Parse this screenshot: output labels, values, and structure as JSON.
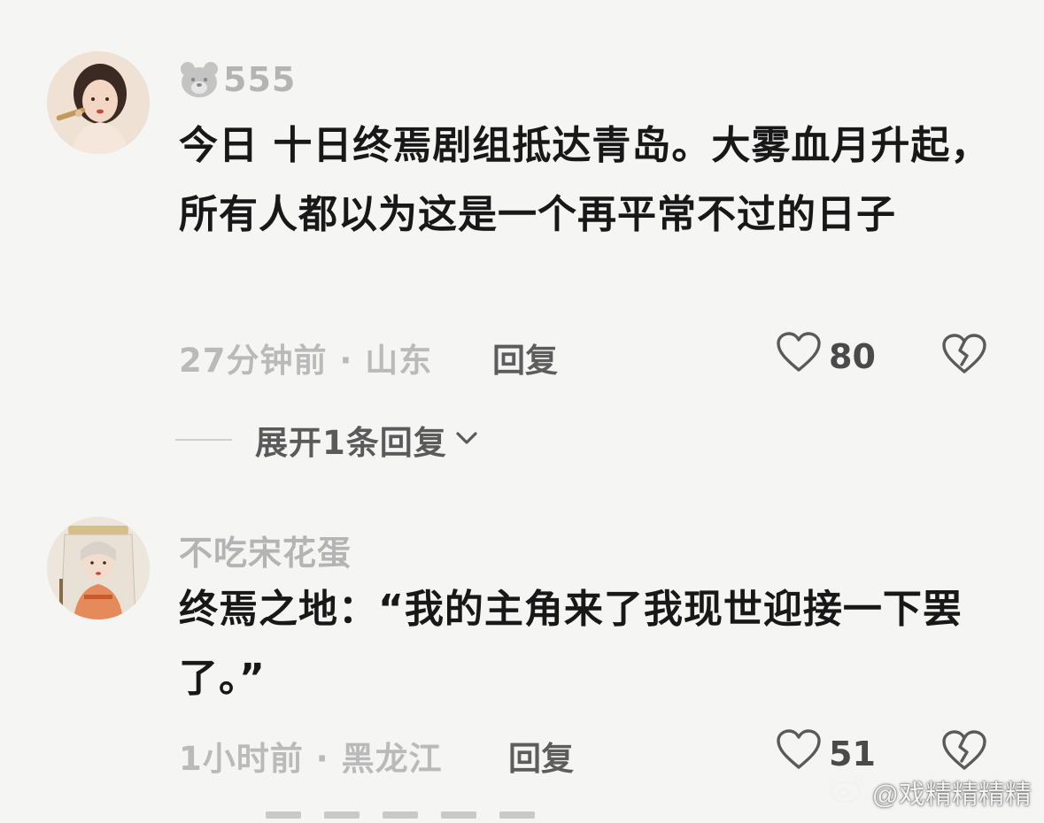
{
  "comments": [
    {
      "username": "555",
      "username_icon": "bear-face-icon",
      "text": "今日  十日终焉剧组抵达青岛。大雾血月升起，所有人都以为这是一个再平常不过的日子",
      "meta": "27分钟前 · 山东",
      "reply_label": "回复",
      "likes": "80",
      "expand_label": "展开1条回复"
    },
    {
      "username": "不吃宋花蛋",
      "text": "终焉之地：“我的主角来了我现世迎接一下罢了。”",
      "meta": "1小时前 · 黑龙江",
      "reply_label": "回复",
      "likes": "51"
    }
  ],
  "watermark": "@戏精精精精",
  "colors": {
    "background": "#f5f5f4",
    "text": "#181818",
    "muted": "#b4b4b4",
    "icon": "#5a5a5a"
  }
}
